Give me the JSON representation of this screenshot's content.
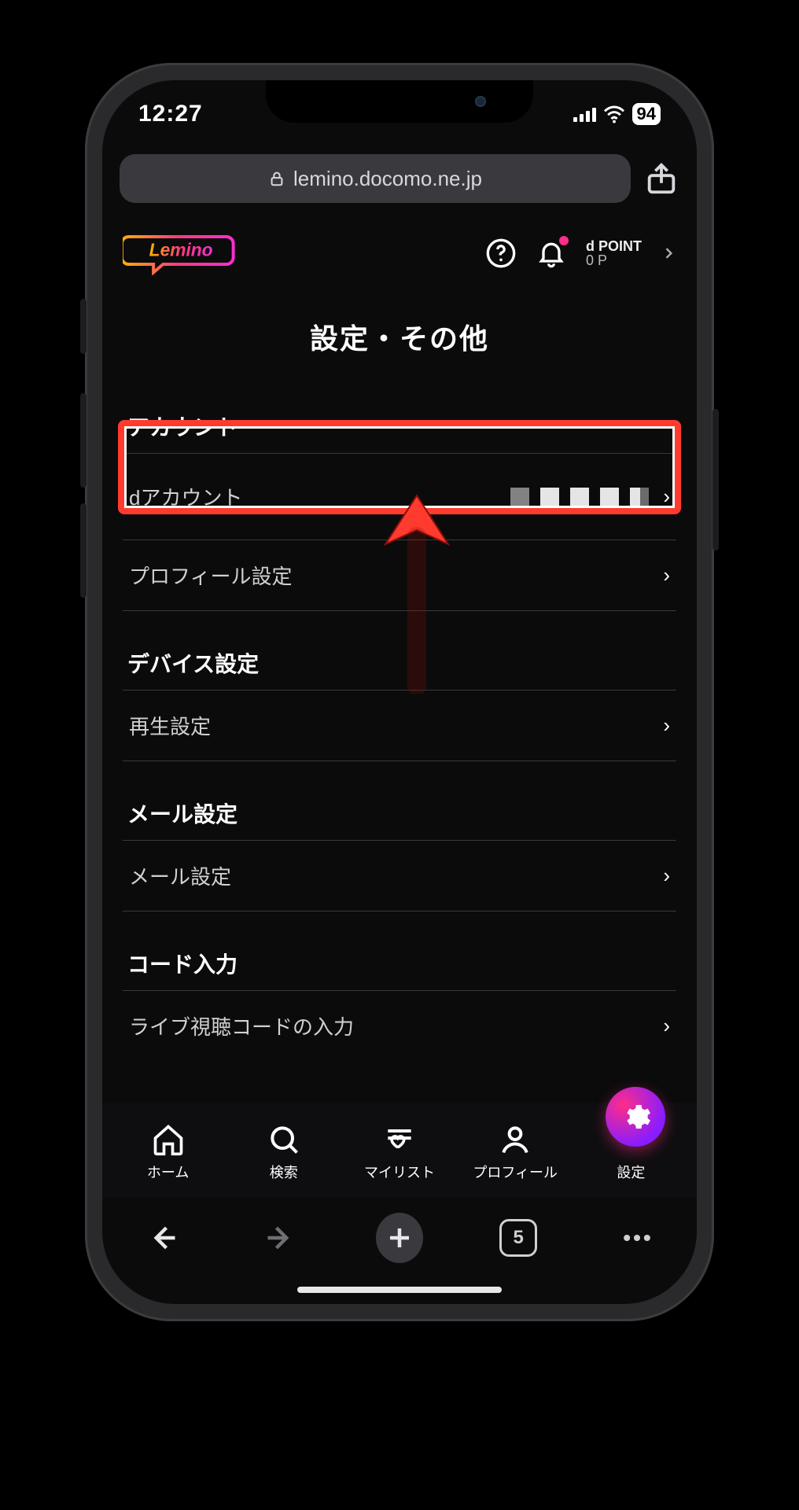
{
  "status": {
    "time": "12:27",
    "battery": "94"
  },
  "browser": {
    "domain": "lemino.docomo.ne.jp",
    "tab_count": "5"
  },
  "header": {
    "logo_text": "Lemino",
    "dpoint_label": "d POINT",
    "dpoint_value": "0 P"
  },
  "page": {
    "title": "設定・その他",
    "sections": [
      {
        "title": "アカウント",
        "rows": [
          {
            "label": "dアカウント",
            "value_masked": true
          },
          {
            "label": "プロフィール設定"
          }
        ]
      },
      {
        "title": "デバイス設定",
        "rows": [
          {
            "label": "再生設定"
          }
        ]
      },
      {
        "title": "メール設定",
        "rows": [
          {
            "label": "メール設定"
          }
        ]
      },
      {
        "title": "コード入力",
        "rows": [
          {
            "label": "ライブ視聴コードの入力"
          }
        ]
      }
    ]
  },
  "nav": {
    "items": [
      {
        "label": "ホーム"
      },
      {
        "label": "検索"
      },
      {
        "label": "マイリスト"
      },
      {
        "label": "プロフィール"
      },
      {
        "label": "設定"
      }
    ]
  }
}
